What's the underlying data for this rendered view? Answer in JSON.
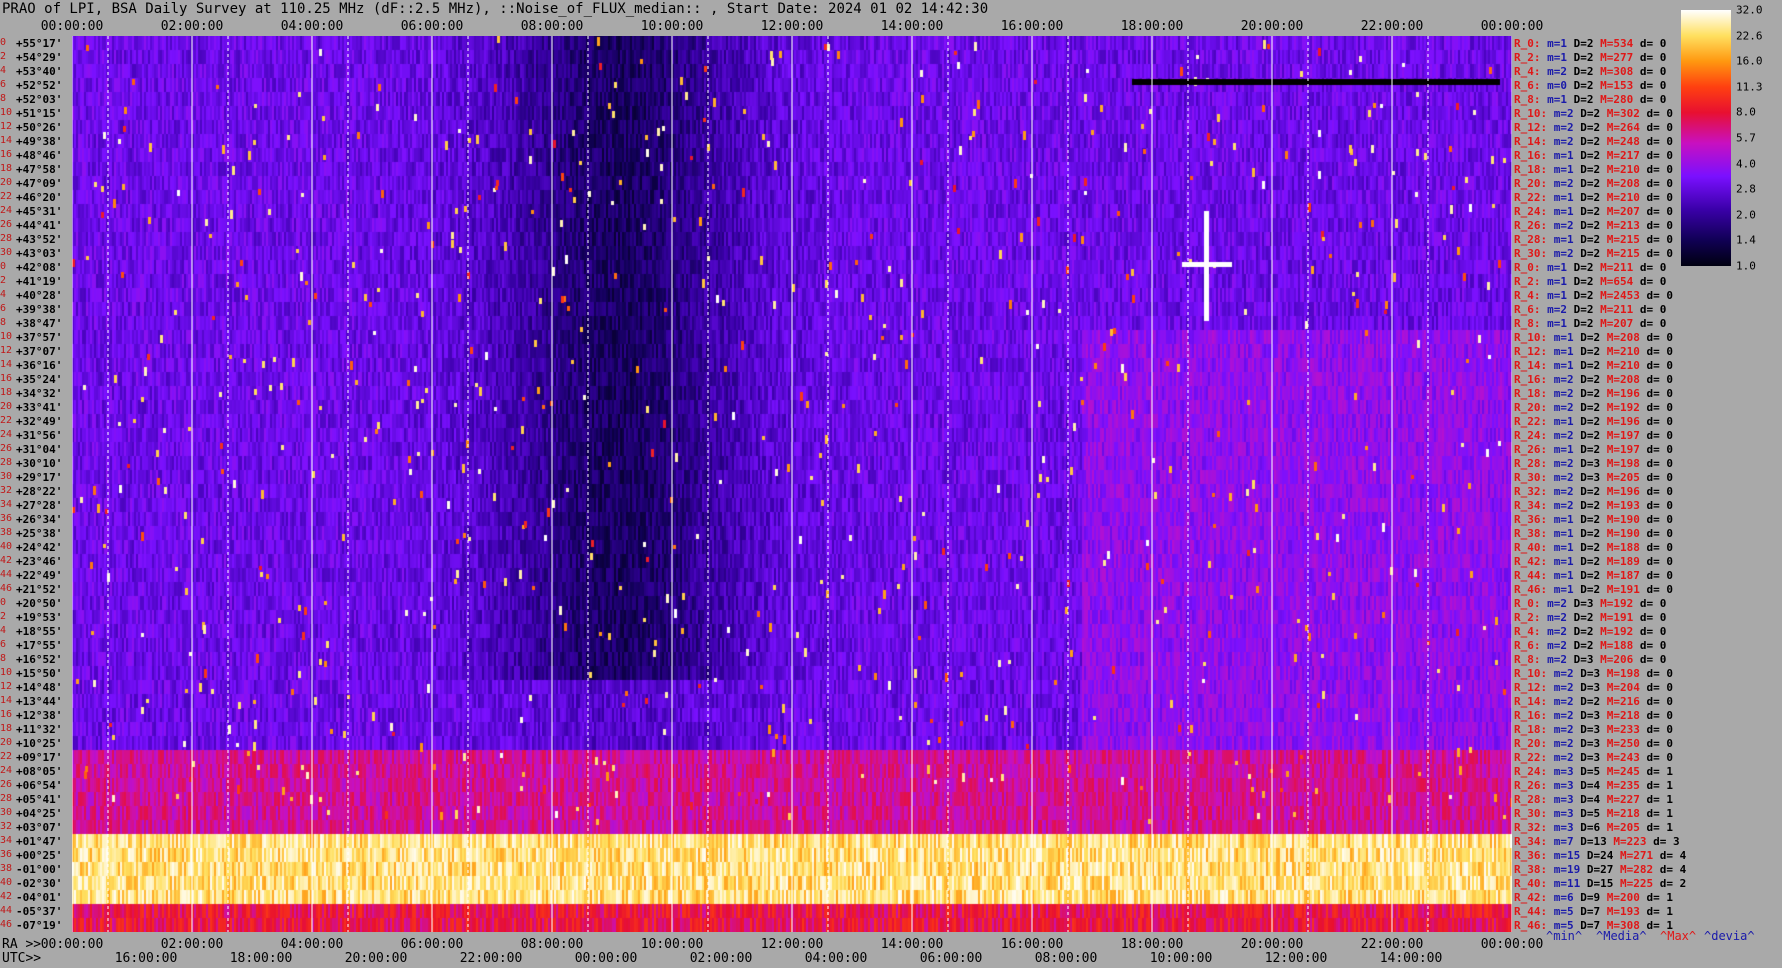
{
  "title": "PRAO of LPI, BSA Daily Survey at 110.25 MHz (dF::2.5 MHz), ::Noise_of_FLUX_median:: , Start Date: 2024 01 02 14:42:30",
  "top_ticks": [
    "00:00:00",
    "02:00:00",
    "04:00:00",
    "06:00:00",
    "08:00:00",
    "10:00:00",
    "12:00:00",
    "14:00:00",
    "16:00:00",
    "18:00:00",
    "20:00:00",
    "22:00:00",
    "00:00:00"
  ],
  "ra_label": "RA >>",
  "ra_ticks": [
    "00:00:00",
    "02:00:00",
    "04:00:00",
    "06:00:00",
    "08:00:00",
    "10:00:00",
    "12:00:00",
    "14:00:00",
    "16:00:00",
    "18:00:00",
    "20:00:00",
    "22:00:00",
    "00:00:00"
  ],
  "utc_label": "UTC>>",
  "utc_ticks": [
    "16:00:00",
    "18:00:00",
    "20:00:00",
    "22:00:00",
    "00:00:00",
    "02:00:00",
    "04:00:00",
    "06:00:00",
    "08:00:00",
    "10:00:00",
    "12:00:00",
    "14:00:00"
  ],
  "declinations": [
    "+55°17'",
    "+54°29'",
    "+53°40'",
    "+52°52'",
    "+52°03'",
    "+51°15'",
    "+50°26'",
    "+49°38'",
    "+48°46'",
    "+47°58'",
    "+47°09'",
    "+46°20'",
    "+45°31'",
    "+44°41'",
    "+43°52'",
    "+43°03'",
    "+42°08'",
    "+41°19'",
    "+40°28'",
    "+39°38'",
    "+38°47'",
    "+37°57'",
    "+37°07'",
    "+36°16'",
    "+35°24'",
    "+34°32'",
    "+33°41'",
    "+32°49'",
    "+31°56'",
    "+31°04'",
    "+30°10'",
    "+29°17'",
    "+28°22'",
    "+27°28'",
    "+26°34'",
    "+25°38'",
    "+24°42'",
    "+23°46'",
    "+22°49'",
    "+21°52'",
    "+20°50'",
    "+19°53'",
    "+18°55'",
    "+17°55'",
    "+16°52'",
    "+15°50'",
    "+14°48'",
    "+13°44'",
    "+12°38'",
    "+11°32'",
    "+10°25'",
    "+09°17'",
    "+08°05'",
    "+06°54'",
    "+05°41'",
    "+04°25'",
    "+03°07'",
    "+01°47'",
    "+00°25'",
    "-01°00'",
    "-02°30'",
    "-04°01'",
    "-05°37'",
    "-07°19'"
  ],
  "row_indices": [
    "0",
    "2",
    "4",
    "6",
    "8",
    "10",
    "12",
    "14",
    "16",
    "18",
    "20",
    "22",
    "24",
    "26",
    "28",
    "30",
    "0",
    "2",
    "4",
    "6",
    "8",
    "10",
    "12",
    "14",
    "16",
    "18",
    "20",
    "22",
    "24",
    "26",
    "28",
    "30",
    "32",
    "34",
    "36",
    "38",
    "40",
    "42",
    "44",
    "46",
    "0",
    "2",
    "4",
    "6",
    "8",
    "10",
    "12",
    "14",
    "16",
    "18",
    "20",
    "22",
    "24",
    "26",
    "28",
    "30",
    "32",
    "34",
    "36",
    "38",
    "40",
    "42",
    "44",
    "46"
  ],
  "right_rows": [
    {
      "r": "R_0:",
      "m": "m=1",
      "d": "D=2",
      "mx": "M=534",
      "dv": "d= 0"
    },
    {
      "r": "R_2:",
      "m": "m=1",
      "d": "D=2",
      "mx": "M=277",
      "dv": "d= 0"
    },
    {
      "r": "R_4:",
      "m": "m=2",
      "d": "D=2",
      "mx": "M=308",
      "dv": "d= 0"
    },
    {
      "r": "R_6:",
      "m": "m=0",
      "d": "D=2",
      "mx": "M=153",
      "dv": "d= 0"
    },
    {
      "r": "R_8:",
      "m": "m=1",
      "d": "D=2",
      "mx": "M=280",
      "dv": "d= 0"
    },
    {
      "r": "R_10:",
      "m": "m=2",
      "d": "D=2",
      "mx": "M=302",
      "dv": "d= 0"
    },
    {
      "r": "R_12:",
      "m": "m=2",
      "d": "D=2",
      "mx": "M=264",
      "dv": "d= 0"
    },
    {
      "r": "R_14:",
      "m": "m=2",
      "d": "D=2",
      "mx": "M=248",
      "dv": "d= 0"
    },
    {
      "r": "R_16:",
      "m": "m=1",
      "d": "D=2",
      "mx": "M=217",
      "dv": "d= 0"
    },
    {
      "r": "R_18:",
      "m": "m=1",
      "d": "D=2",
      "mx": "M=210",
      "dv": "d= 0"
    },
    {
      "r": "R_20:",
      "m": "m=2",
      "d": "D=2",
      "mx": "M=208",
      "dv": "d= 0"
    },
    {
      "r": "R_22:",
      "m": "m=1",
      "d": "D=2",
      "mx": "M=210",
      "dv": "d= 0"
    },
    {
      "r": "R_24:",
      "m": "m=1",
      "d": "D=2",
      "mx": "M=207",
      "dv": "d= 0"
    },
    {
      "r": "R_26:",
      "m": "m=2",
      "d": "D=2",
      "mx": "M=213",
      "dv": "d= 0"
    },
    {
      "r": "R_28:",
      "m": "m=1",
      "d": "D=2",
      "mx": "M=215",
      "dv": "d= 0"
    },
    {
      "r": "R_30:",
      "m": "m=2",
      "d": "D=2",
      "mx": "M=215",
      "dv": "d= 0"
    },
    {
      "r": "R_0:",
      "m": "m=1",
      "d": "D=2",
      "mx": "M=211",
      "dv": "d= 0"
    },
    {
      "r": "R_2:",
      "m": "m=1",
      "d": "D=2",
      "mx": "M=654",
      "dv": "d= 0"
    },
    {
      "r": "R_4:",
      "m": "m=1",
      "d": "D=2",
      "mx": "M=2453",
      "dv": "d= 0"
    },
    {
      "r": "R_6:",
      "m": "m=2",
      "d": "D=2",
      "mx": "M=211",
      "dv": "d= 0"
    },
    {
      "r": "R_8:",
      "m": "m=1",
      "d": "D=2",
      "mx": "M=207",
      "dv": "d= 0"
    },
    {
      "r": "R_10:",
      "m": "m=1",
      "d": "D=2",
      "mx": "M=208",
      "dv": "d= 0"
    },
    {
      "r": "R_12:",
      "m": "m=1",
      "d": "D=2",
      "mx": "M=210",
      "dv": "d= 0"
    },
    {
      "r": "R_14:",
      "m": "m=1",
      "d": "D=2",
      "mx": "M=210",
      "dv": "d= 0"
    },
    {
      "r": "R_16:",
      "m": "m=2",
      "d": "D=2",
      "mx": "M=208",
      "dv": "d= 0"
    },
    {
      "r": "R_18:",
      "m": "m=2",
      "d": "D=2",
      "mx": "M=196",
      "dv": "d= 0"
    },
    {
      "r": "R_20:",
      "m": "m=2",
      "d": "D=2",
      "mx": "M=192",
      "dv": "d= 0"
    },
    {
      "r": "R_22:",
      "m": "m=1",
      "d": "D=2",
      "mx": "M=196",
      "dv": "d= 0"
    },
    {
      "r": "R_24:",
      "m": "m=2",
      "d": "D=2",
      "mx": "M=197",
      "dv": "d= 0"
    },
    {
      "r": "R_26:",
      "m": "m=1",
      "d": "D=2",
      "mx": "M=197",
      "dv": "d= 0"
    },
    {
      "r": "R_28:",
      "m": "m=2",
      "d": "D=3",
      "mx": "M=198",
      "dv": "d= 0"
    },
    {
      "r": "R_30:",
      "m": "m=2",
      "d": "D=3",
      "mx": "M=205",
      "dv": "d= 0"
    },
    {
      "r": "R_32:",
      "m": "m=2",
      "d": "D=2",
      "mx": "M=196",
      "dv": "d= 0"
    },
    {
      "r": "R_34:",
      "m": "m=2",
      "d": "D=2",
      "mx": "M=193",
      "dv": "d= 0"
    },
    {
      "r": "R_36:",
      "m": "m=1",
      "d": "D=2",
      "mx": "M=190",
      "dv": "d= 0"
    },
    {
      "r": "R_38:",
      "m": "m=1",
      "d": "D=2",
      "mx": "M=190",
      "dv": "d= 0"
    },
    {
      "r": "R_40:",
      "m": "m=1",
      "d": "D=2",
      "mx": "M=188",
      "dv": "d= 0"
    },
    {
      "r": "R_42:",
      "m": "m=1",
      "d": "D=2",
      "mx": "M=189",
      "dv": "d= 0"
    },
    {
      "r": "R_44:",
      "m": "m=1",
      "d": "D=2",
      "mx": "M=187",
      "dv": "d= 0"
    },
    {
      "r": "R_46:",
      "m": "m=1",
      "d": "D=2",
      "mx": "M=191",
      "dv": "d= 0"
    },
    {
      "r": "R_0:",
      "m": "m=2",
      "d": "D=3",
      "mx": "M=192",
      "dv": "d= 0"
    },
    {
      "r": "R_2:",
      "m": "m=2",
      "d": "D=2",
      "mx": "M=191",
      "dv": "d= 0"
    },
    {
      "r": "R_4:",
      "m": "m=2",
      "d": "D=2",
      "mx": "M=192",
      "dv": "d= 0"
    },
    {
      "r": "R_6:",
      "m": "m=2",
      "d": "D=2",
      "mx": "M=188",
      "dv": "d= 0"
    },
    {
      "r": "R_8:",
      "m": "m=2",
      "d": "D=3",
      "mx": "M=206",
      "dv": "d= 0"
    },
    {
      "r": "R_10:",
      "m": "m=2",
      "d": "D=3",
      "mx": "M=198",
      "dv": "d= 0"
    },
    {
      "r": "R_12:",
      "m": "m=2",
      "d": "D=3",
      "mx": "M=204",
      "dv": "d= 0"
    },
    {
      "r": "R_14:",
      "m": "m=2",
      "d": "D=2",
      "mx": "M=216",
      "dv": "d= 0"
    },
    {
      "r": "R_16:",
      "m": "m=2",
      "d": "D=3",
      "mx": "M=218",
      "dv": "d= 0"
    },
    {
      "r": "R_18:",
      "m": "m=2",
      "d": "D=3",
      "mx": "M=233",
      "dv": "d= 0"
    },
    {
      "r": "R_20:",
      "m": "m=2",
      "d": "D=3",
      "mx": "M=250",
      "dv": "d= 0"
    },
    {
      "r": "R_22:",
      "m": "m=2",
      "d": "D=3",
      "mx": "M=243",
      "dv": "d= 0"
    },
    {
      "r": "R_24:",
      "m": "m=3",
      "d": "D=5",
      "mx": "M=245",
      "dv": "d= 1"
    },
    {
      "r": "R_26:",
      "m": "m=3",
      "d": "D=4",
      "mx": "M=235",
      "dv": "d= 1"
    },
    {
      "r": "R_28:",
      "m": "m=3",
      "d": "D=4",
      "mx": "M=227",
      "dv": "d= 1"
    },
    {
      "r": "R_30:",
      "m": "m=3",
      "d": "D=5",
      "mx": "M=218",
      "dv": "d= 1"
    },
    {
      "r": "R_32:",
      "m": "m=3",
      "d": "D=6",
      "mx": "M=205",
      "dv": "d= 1"
    },
    {
      "r": "R_34:",
      "m": "m=7",
      "d": "D=13",
      "mx": "M=223",
      "dv": "d= 3"
    },
    {
      "r": "R_36:",
      "m": "m=15",
      "d": "D=24",
      "mx": "M=271",
      "dv": "d= 4"
    },
    {
      "r": "R_38:",
      "m": "m=19",
      "d": "D=27",
      "mx": "M=282",
      "dv": "d= 4"
    },
    {
      "r": "R_40:",
      "m": "m=11",
      "d": "D=15",
      "mx": "M=225",
      "dv": "d= 2"
    },
    {
      "r": "R_42:",
      "m": "m=6",
      "d": "D=9",
      "mx": "M=200",
      "dv": "d= 1"
    },
    {
      "r": "R_44:",
      "m": "m=5",
      "d": "D=7",
      "mx": "M=193",
      "dv": "d= 1"
    },
    {
      "r": "R_46:",
      "m": "m=5",
      "d": "D=7",
      "mx": "M=308",
      "dv": "d= 1"
    }
  ],
  "colorbar_labels": [
    "32.0",
    "22.6",
    "16.0",
    "11.3",
    "8.0",
    "5.7",
    "4.0",
    "2.8",
    "2.0",
    "1.4",
    "1.0"
  ],
  "legend": {
    "min": "^min^",
    "median": "^Media^",
    "max": "^Max^",
    "devia": "^devia^"
  },
  "colors": {
    "bg": "#a9a9a9",
    "label_red": "#e01818",
    "label_blue": "#1a1aaa"
  },
  "chart_data": {
    "type": "heatmap",
    "title": "PRAO of LPI, BSA Daily Survey at 110.25 MHz (dF::2.5 MHz), ::Noise_of_FLUX_median:: , Start Date: 2024 01 02 14:42:30",
    "x_axis": "RA 00:00:00 to 24:00:00",
    "y_axis": "Declination +55°17' to -07°19' (64 beams)",
    "color_scale": [
      1.0,
      32.0
    ],
    "colorbar_ticks": [
      32.0,
      22.6,
      16.0,
      11.3,
      8.0,
      5.7,
      4.0,
      2.8,
      2.0,
      1.4,
      1.0
    ],
    "colormap": "dark blue - purple - magenta - red - orange - yellow - white",
    "row_band_levels": [
      {
        "rows": "0-50",
        "typical": 3.0
      },
      {
        "rows": "51-56",
        "typical": 6.0
      },
      {
        "rows": "57-61",
        "typical": 24.0
      },
      {
        "rows": "62-63",
        "typical": 8.0
      }
    ]
  }
}
